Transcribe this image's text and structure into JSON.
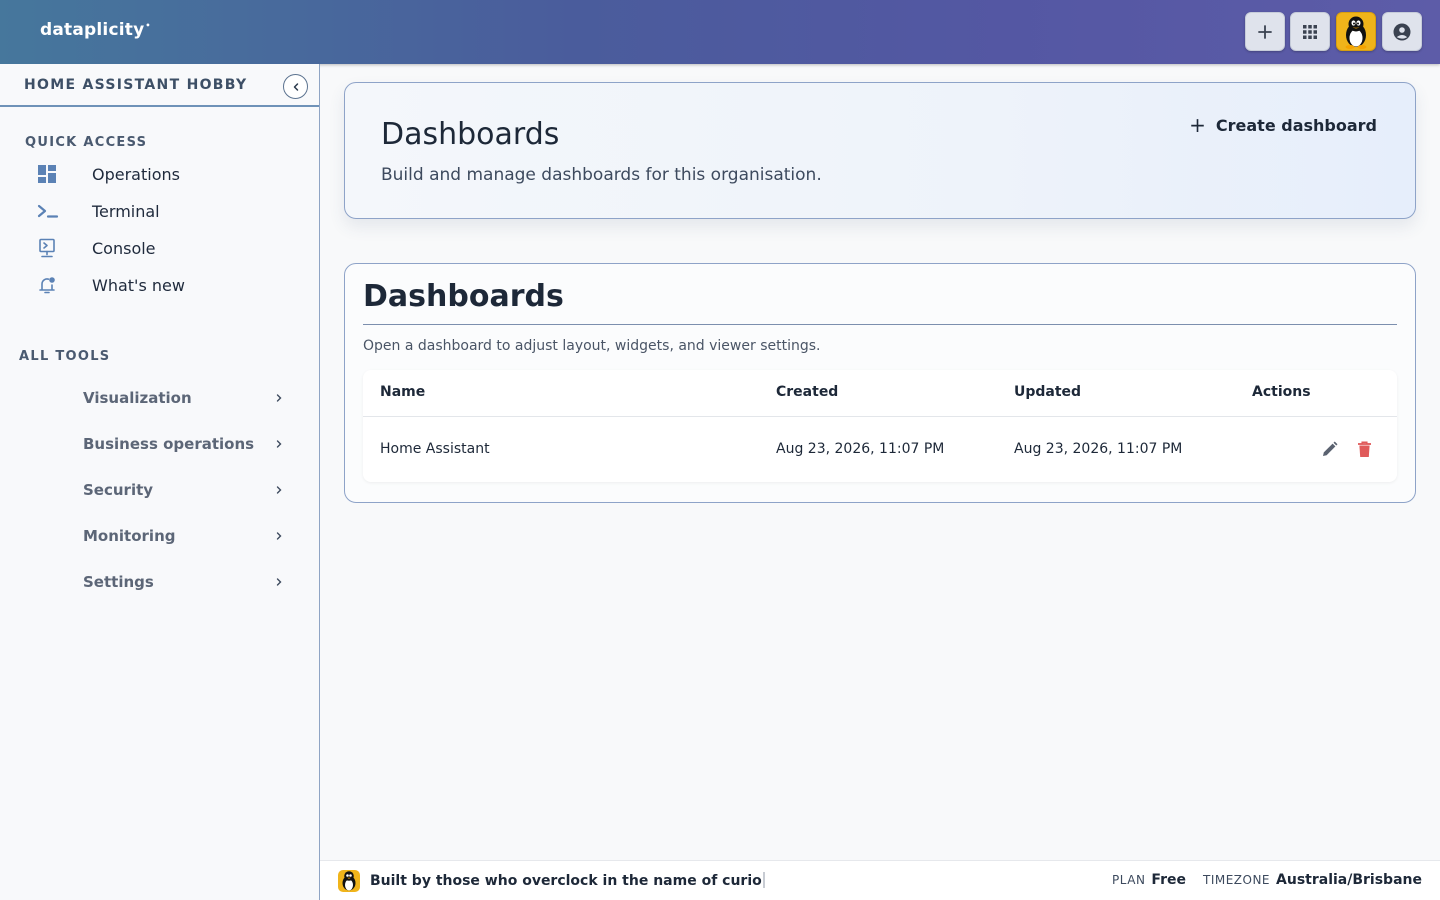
{
  "app": {
    "brand": "dataplicity",
    "brand_mark": "•"
  },
  "topbar": {
    "icons": [
      "plus-icon",
      "apps-grid-icon",
      "tux-avatar-icon",
      "account-circle-icon"
    ]
  },
  "sidebar": {
    "org_name": "HOME ASSISTANT HOBBY",
    "quick_access_label": "QUICK ACCESS",
    "quick_access": [
      {
        "label": "Operations",
        "icon": "dashboard-icon"
      },
      {
        "label": "Terminal",
        "icon": "terminal-icon"
      },
      {
        "label": "Console",
        "icon": "console-icon"
      },
      {
        "label": "What's new",
        "icon": "notification-bell-icon"
      }
    ],
    "all_tools_label": "ALL TOOLS",
    "tools": [
      {
        "label": "Visualization"
      },
      {
        "label": "Business operations"
      },
      {
        "label": "Security"
      },
      {
        "label": "Monitoring"
      },
      {
        "label": "Settings"
      }
    ]
  },
  "hero": {
    "title": "Dashboards",
    "subtitle": "Build and manage dashboards for this organisation.",
    "create_plus": "+",
    "create_label": "Create dashboard"
  },
  "panel": {
    "title": "Dashboards",
    "description": "Open a dashboard to adjust layout, widgets, and viewer settings.",
    "columns": [
      "Name",
      "Created",
      "Updated",
      "Actions"
    ],
    "rows": [
      {
        "name": "Home Assistant",
        "created": "Aug 23, 2026, 11:07 PM",
        "updated": "Aug 23, 2026, 11:07 PM"
      }
    ]
  },
  "footer": {
    "tagline": "Built by those who overclock in the name of curio",
    "plan_label": "PLAN",
    "plan_value": "Free",
    "timezone_label": "TIMEZONE",
    "timezone_value": "Australia/Brisbane"
  },
  "colors": {
    "accent": "#4a5c9c",
    "delete": "#e05a5a",
    "tux_bg": "#f0b41a"
  }
}
